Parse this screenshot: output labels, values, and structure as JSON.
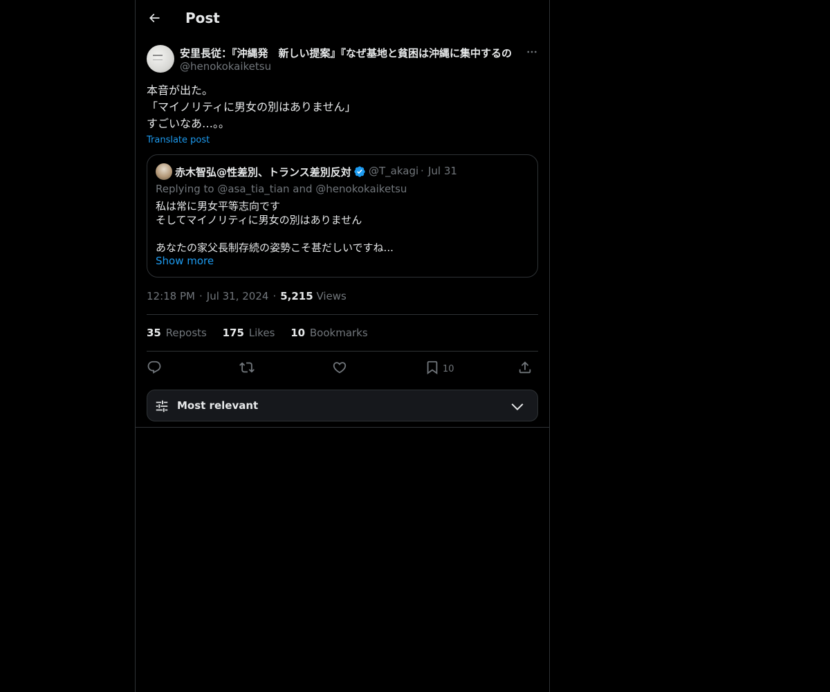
{
  "header": {
    "title": "Post"
  },
  "post": {
    "author_name": "安里長従：『沖縄発　新しい提案』『なぜ基地と貧困は沖縄に集中するの",
    "author_handle": "@henokokaiketsu",
    "text_lines": [
      "本音が出た。",
      "「マイノリティに男女の別はありません」",
      "すごいなあ…。。"
    ],
    "translate_label": "Translate post",
    "time": "12:18 PM",
    "date": "Jul 31, 2024",
    "views_count": "5,215",
    "views_label": "Views"
  },
  "quote": {
    "name": "赤木智弘@性差別、トランス差別反対",
    "handle": "@T_akagi",
    "date": "Jul 31",
    "replying": "Replying to @asa_tia_tian and @henokokaiketsu",
    "text_lines": [
      "私は常に男女平等志向です",
      "そしてマイノリティに男女の別はありません",
      "",
      "あなたの家父長制存続の姿勢こそ甚だしいですね..."
    ],
    "show_more": "Show more"
  },
  "stats": {
    "reposts_count": "35",
    "reposts_label": "Reposts",
    "likes_count": "175",
    "likes_label": "Likes",
    "bookmarks_count": "10",
    "bookmarks_label": "Bookmarks"
  },
  "actions": {
    "bookmark_count": "10"
  },
  "sort": {
    "label": "Most relevant"
  },
  "icons": {
    "back": "arrow-left-icon",
    "more": "more-dots-icon",
    "verified": "verified-badge-icon",
    "reply": "reply-icon",
    "repost": "repost-icon",
    "like": "heart-icon",
    "bookmark": "bookmark-icon",
    "share": "share-icon",
    "sort": "sliders-icon",
    "chevron": "chevron-down-icon"
  },
  "colors": {
    "background": "#000000",
    "accent": "#1d9bf0",
    "muted": "#71767b",
    "text": "#e7e9ea",
    "border": "#2f3336"
  }
}
